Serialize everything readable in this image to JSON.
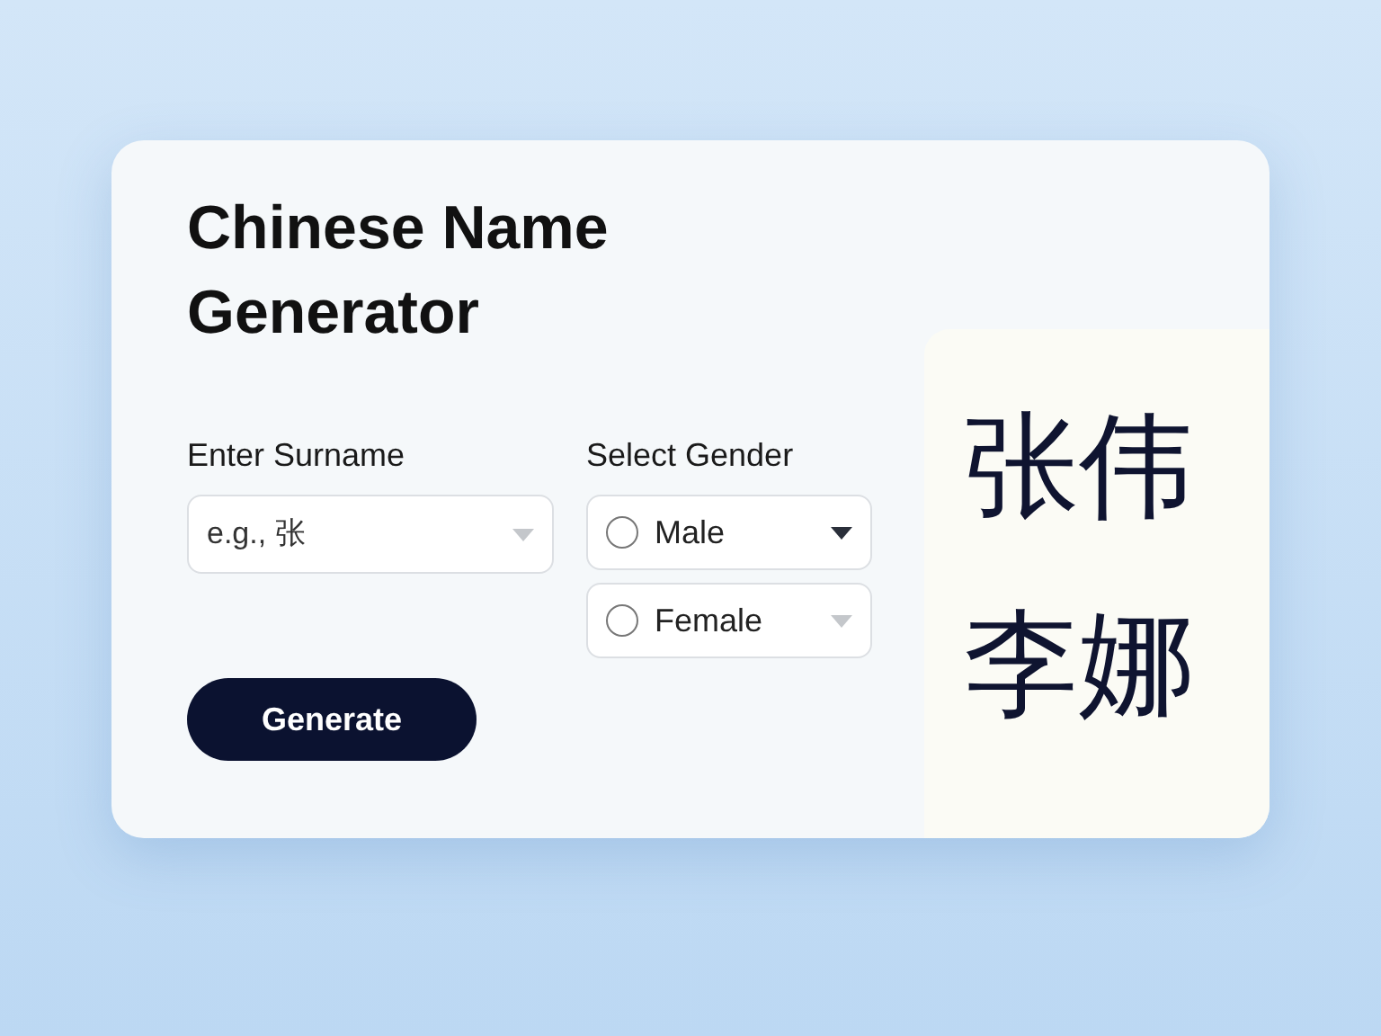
{
  "title": "Chinese Name Generator",
  "surname": {
    "label": "Enter Surname",
    "placeholder": "e.g., 张"
  },
  "gender": {
    "label": "Select Gender",
    "options": [
      {
        "label": "Male",
        "selected": false
      },
      {
        "label": "Female",
        "selected": false
      }
    ]
  },
  "button": "Generate",
  "results": [
    "张伟",
    "李娜"
  ]
}
